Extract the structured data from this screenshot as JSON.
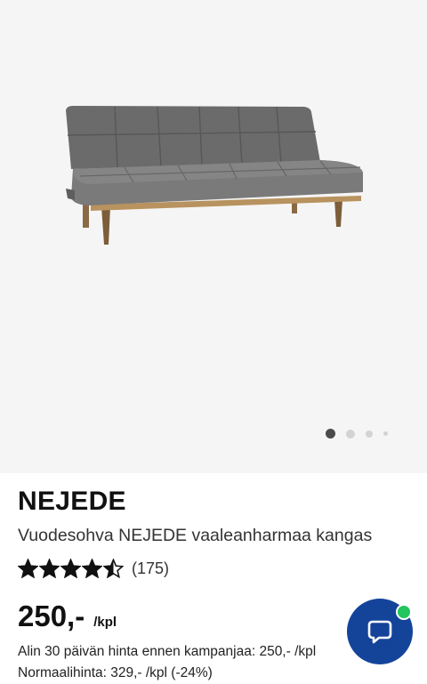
{
  "gallery": {
    "image_alt": "Vuodesohva NEJEDE vaaleanharmaa kangas",
    "slide_count": 4,
    "active_slide": 1
  },
  "product": {
    "brand": "NEJEDE",
    "title": "Vuodesohva NEJEDE vaaleanharmaa kangas",
    "rating": 4.5,
    "rating_max": 5,
    "review_count": "(175)",
    "price": "250,-",
    "price_unit": "/kpl",
    "lowest_price_text": "Alin 30 päivän hinta ennen kampanjaa: 250,- /kpl",
    "normal_price_text": "Normaalihinta: 329,- /kpl (-24%)"
  },
  "chat": {
    "icon": "chat-bubble-icon",
    "online_status": "online"
  },
  "colors": {
    "hero_background": "#f5f5f5",
    "chat_button": "#14449a",
    "online_badge": "#22c55e",
    "active_dot": "#4a4a4a",
    "inactive_dot": "#d3d3d3"
  }
}
